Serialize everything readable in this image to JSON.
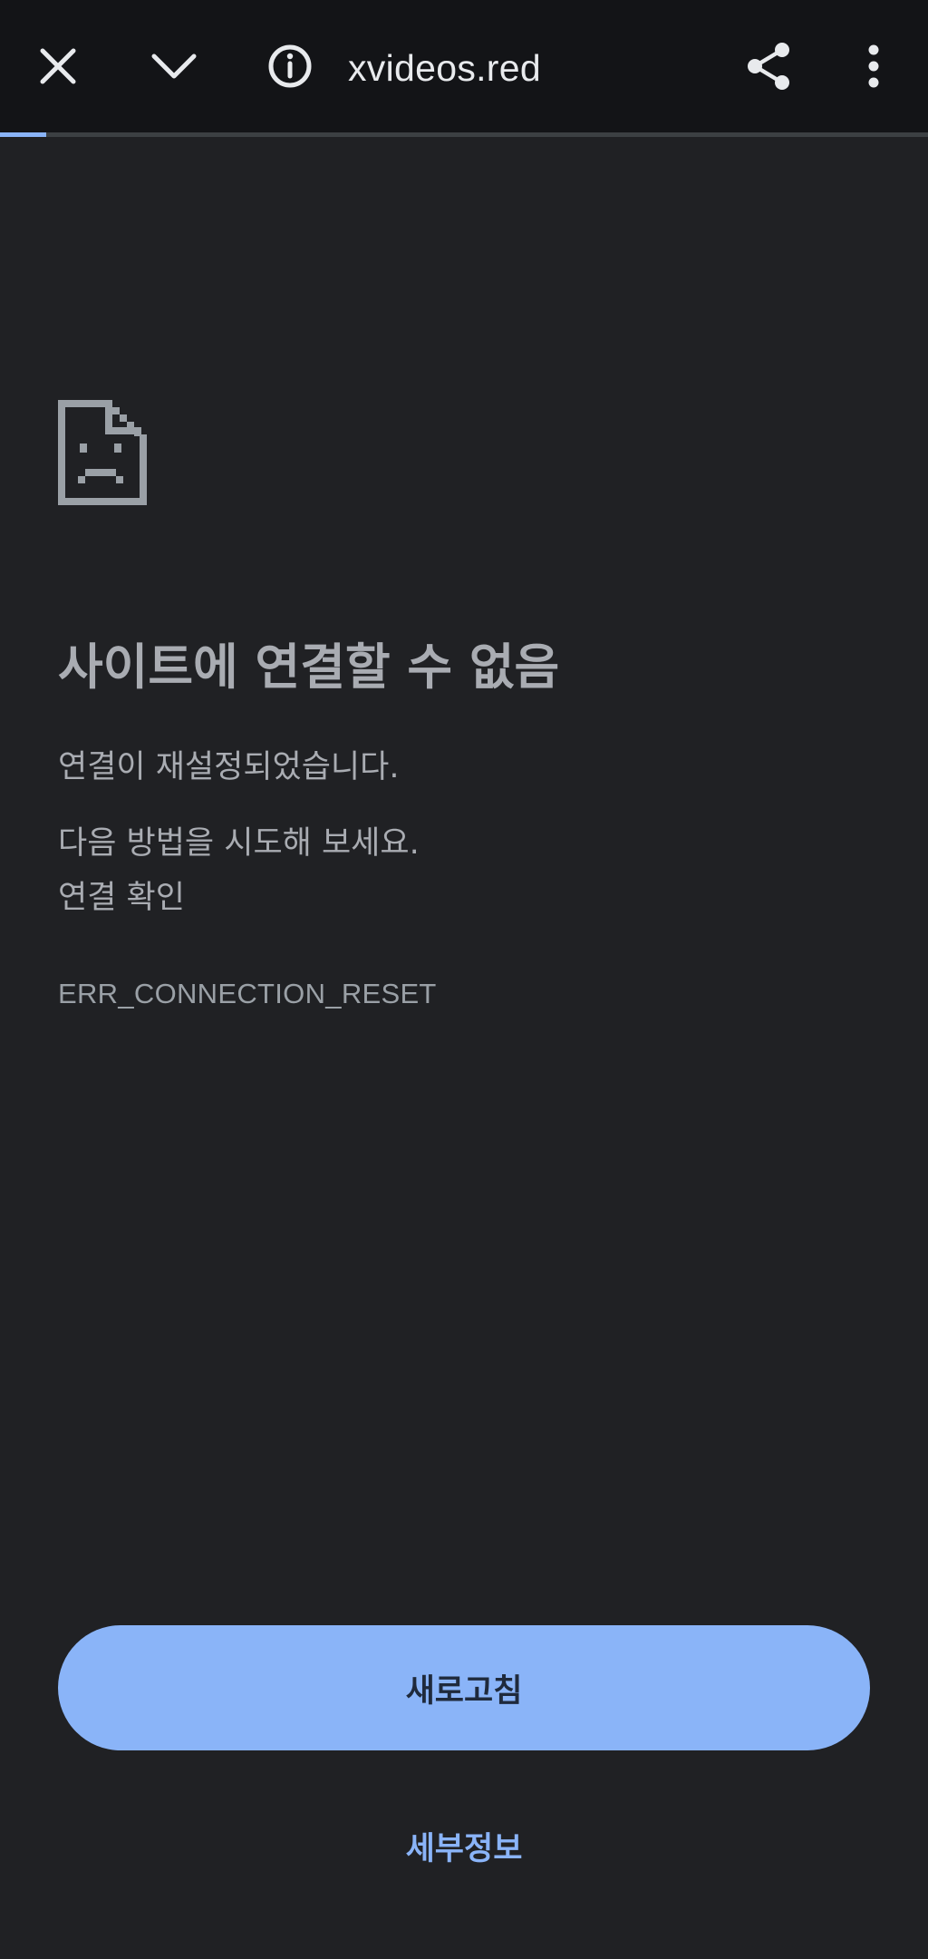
{
  "toolbar": {
    "url": "xvideos.red",
    "icons": {
      "close": "close-icon",
      "minimize": "chevron-down-icon",
      "info": "info-icon",
      "share": "share-icon",
      "menu": "more-vert-icon"
    },
    "load_progress": 0.05
  },
  "error_page": {
    "icon": "sad-page-icon",
    "title": "사이트에 연결할 수 없음",
    "message": "연결이 재설정되었습니다.",
    "suggestion_intro": "다음 방법을 시도해 보세요.",
    "suggestion_item": "연결 확인",
    "error_code": "ERR_CONNECTION_RESET",
    "reload_label": "새로고침",
    "details_label": "세부정보"
  },
  "colors": {
    "background": "#202124",
    "toolbar": "#131417",
    "accent": "#8ab4f8",
    "text": "#a9acb2"
  }
}
